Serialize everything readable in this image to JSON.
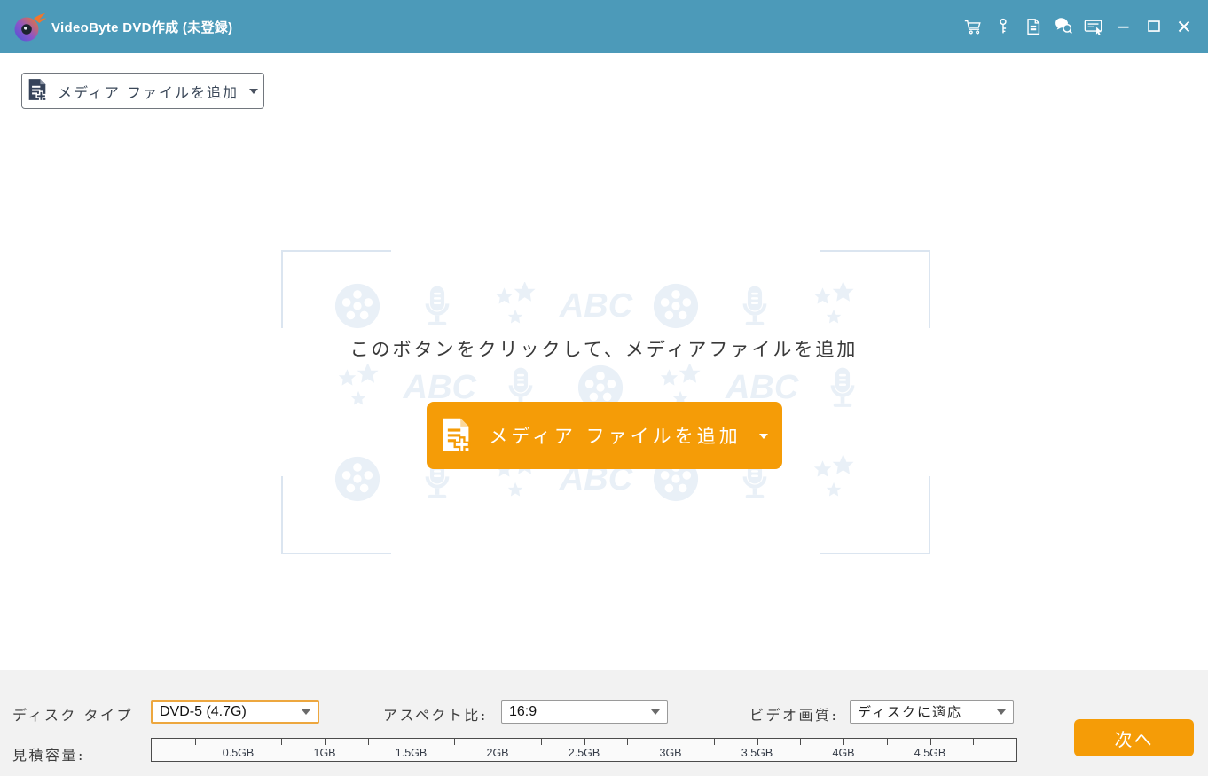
{
  "window": {
    "title": "VideoByte DVD作成 (未登録)"
  },
  "titlebar": {
    "icons": [
      "cart-icon",
      "key-icon",
      "register-document-icon",
      "feedback-icon",
      "menu-icon",
      "minimize-button",
      "maximize-button",
      "close-button"
    ]
  },
  "toolbar": {
    "add_media_button": "メディア ファイルを追加"
  },
  "dropzone": {
    "hint": "このボタンをクリックして、メディアファイルを追加",
    "add_media_button": "メディア ファイルを追加",
    "abc_text": "ABC",
    "watermark_rows": [
      [
        "film-reel",
        "microphone",
        "stars",
        "abc",
        "film-reel",
        "microphone",
        "stars"
      ],
      [
        "stars",
        "abc",
        "microphone",
        "film-reel",
        "stars",
        "abc",
        "microphone"
      ],
      [
        "film-reel",
        "microphone",
        "stars",
        "abc",
        "film-reel",
        "microphone",
        "stars"
      ]
    ]
  },
  "settings": {
    "disc_type": {
      "label": "ディスク タイプ",
      "value": "DVD-5 (4.7G)"
    },
    "aspect_ratio": {
      "label": "アスペクト比:",
      "value": "16:9"
    },
    "video_quality": {
      "label": "ビデオ画質:",
      "value": "ディスクに適応"
    },
    "capacity": {
      "label": "見積容量:",
      "tick_labels": [
        "0.5GB",
        "1GB",
        "1.5GB",
        "2GB",
        "2.5GB",
        "3GB",
        "3.5GB",
        "4GB",
        "4.5GB"
      ],
      "scale_max_gb": 5.0
    },
    "next_button": "次へ"
  },
  "colors": {
    "titlebar": "#4c9ab9",
    "accent_orange": "#f59c07",
    "watermark": "#e9f0f7",
    "bracket": "#dbe5f0",
    "disc_select_border": "#eda73f"
  }
}
